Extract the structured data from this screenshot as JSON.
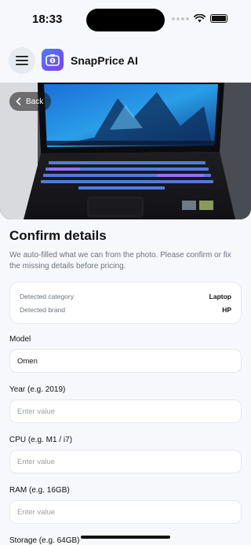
{
  "status_bar": {
    "time": "18:33"
  },
  "header": {
    "app_title": "SnapPrice AI"
  },
  "hero": {
    "back_label": "Back"
  },
  "confirm": {
    "title": "Confirm details",
    "subtitle": "We auto-filled what we can from the photo. Please confirm or fix the missing details before pricing.",
    "detected": [
      {
        "label": "Detected category",
        "value": "Laptop"
      },
      {
        "label": "Detected brand",
        "value": "HP"
      }
    ]
  },
  "fields": {
    "model": {
      "label": "Model",
      "value": "Omen"
    },
    "year": {
      "label": "Year (e.g. 2019)",
      "placeholder": "Enter value"
    },
    "cpu": {
      "label": "CPU (e.g. M1 / i7)",
      "placeholder": "Enter value"
    },
    "ram": {
      "label": "RAM (e.g. 16GB)",
      "placeholder": "Enter value"
    },
    "storage": {
      "label": "Storage (e.g. 64GB)"
    }
  },
  "colors": {
    "accent": "#5b5bf0",
    "background": "#f7f8fb",
    "muted_text": "#6b7280"
  },
  "icons": [
    "wifi-icon",
    "battery-icon",
    "hamburger-menu-icon",
    "snapprice-logo-icon",
    "chevron-left-icon"
  ]
}
